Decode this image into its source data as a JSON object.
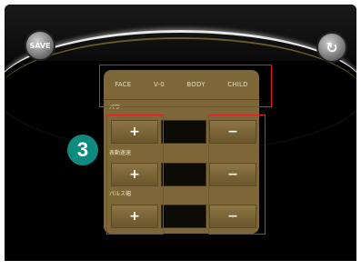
{
  "buttons": {
    "save": "SAVE",
    "reset_glyph": "↻"
  },
  "modes": [
    "FACE",
    "V-0",
    "BODY",
    "CHILD"
  ],
  "sections": [
    {
      "label": "パワー"
    },
    {
      "label": "表動速速"
    },
    {
      "label": "パルス幅"
    }
  ],
  "controls": {
    "plus": "+",
    "minus": "−"
  },
  "annotation": {
    "badge": "3"
  },
  "colors": {
    "panel": "#7d6738",
    "highlight": "#e02020",
    "badge": "#0f8a7e"
  }
}
